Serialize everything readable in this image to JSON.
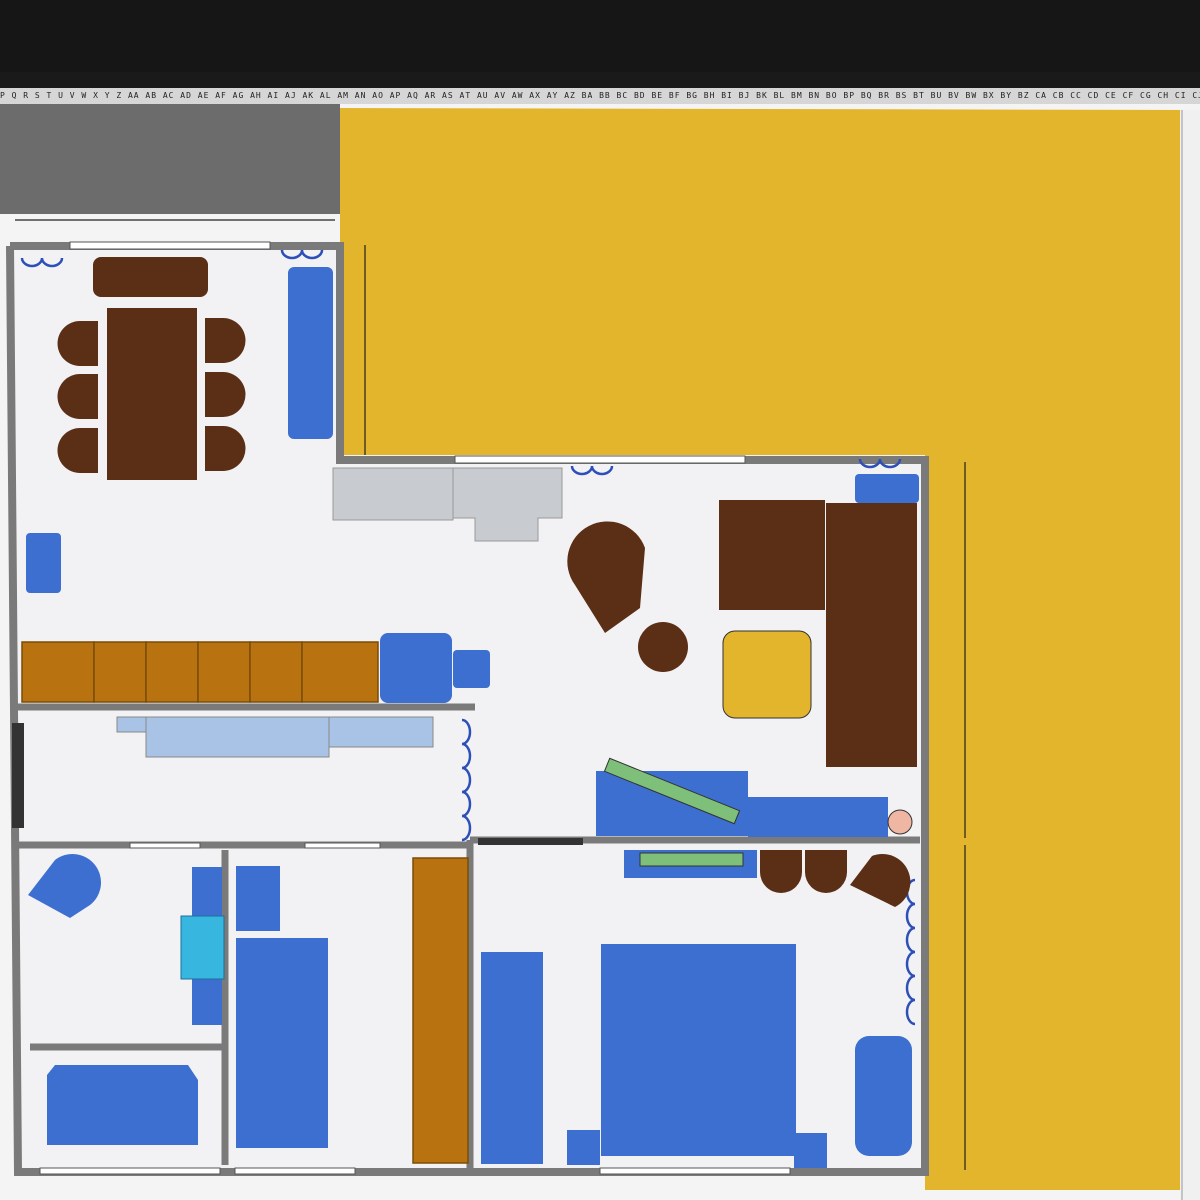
{
  "toolbar": {
    "ruler_text": "P Q R S T U V W X Y Z AA AB AC AD AE AF AG AH AI AJ AK AL AM AN AO AP AQ AR AS AT AU AV AW AX AY AZ BA BB BC BD BE BF BG BH BI BJ BK BL BM BN BO BP BQ BR BS BT BU BV BW BX BY BZ CA CB CC CD CE CF CG CH CI CJ CK CL CM CN CO CP CQ CR CS CT CU CV CW CX CY CZ DA DB DC DD DE DF DG DH DI DJ DK DL DM DN DO DP DQ DR DS DT DU DV DW DX DY DZ"
  },
  "colors": {
    "yard": "#e3b52d",
    "wall": "#7a7a7a",
    "floor": "#f2f2f4",
    "furniture_blue": "#3c6fd0",
    "furniture_dark": "#5b2e16",
    "cabinet_orange": "#b87310",
    "counter_gray": "#c8cbd0",
    "shelf_light": "#a9c3e6",
    "green": "#7ec07a",
    "cyan": "#37b6e0",
    "pink": "#f0b6a4"
  },
  "icons": {
    "door_swing": "door-swing-icon",
    "window": "window-icon"
  }
}
